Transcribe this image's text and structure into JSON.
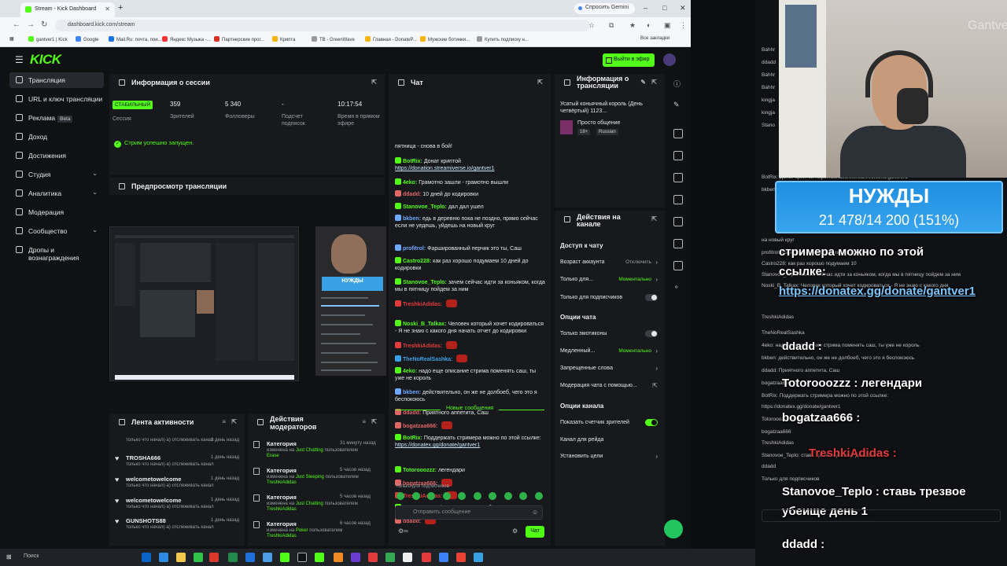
{
  "browser": {
    "tab_title": "Stream - Kick Dashboard",
    "new_tab": "+",
    "gemini": "Спросить Gemini",
    "url": "dashboard.kick.com/stream",
    "bookmarks": [
      "gantver1 | Kick",
      "Google",
      "Mail.Ru: почта, пои...",
      "Яндекс Музыка -...",
      "Партнерские прог...",
      "Крипта",
      "TB - GreenWave",
      "Главная - DonateP...",
      "Мужские ботинки...",
      "Купить подписку н..."
    ],
    "all_bookmarks": "Все закладки"
  },
  "app": {
    "logo": "KICK",
    "go_live": "Выйти в эфир"
  },
  "sidebar": {
    "items": [
      {
        "label": "Трансляция"
      },
      {
        "label": "URL и ключ трансляции"
      },
      {
        "label": "Реклама",
        "badge": "Beta"
      },
      {
        "label": "Доход"
      },
      {
        "label": "Достижения"
      },
      {
        "label": "Студия"
      },
      {
        "label": "Аналитика"
      },
      {
        "label": "Модерация"
      },
      {
        "label": "Сообщество"
      },
      {
        "label": "Дропы и вознаграждения"
      }
    ]
  },
  "session": {
    "title": "Информация о сессии",
    "live_badge": "СТАБИЛЬНЫЙ",
    "session_label": "Сессия",
    "viewers_value": "359",
    "viewers_label": "Зрителей",
    "followers_value": "5 340",
    "followers_label": "Фолловеры",
    "subs_value": "-",
    "subs_label": "Подсчет подписок",
    "time_value": "10:17:54",
    "time_label": "Время в прямом эфире",
    "status": "Стрим успешно запущен."
  },
  "preview": {
    "title": "Предпросмотр трансляции",
    "overlay_text": "НУЖДЫ"
  },
  "activity": {
    "title": "Лента активности",
    "rows": [
      {
        "name": "TROSHA666",
        "text": "только что начал(-а) отслеживать канал",
        "date": "1 день назад"
      },
      {
        "name": "welcometowelcome",
        "text": "только что начал(-а) отслеживать канал",
        "date": "1 день назад"
      },
      {
        "name": "welcometowelcome",
        "text": "только что начал(-а) отслеживать канал",
        "date": "1 день назад"
      },
      {
        "name": "GUNSHOTS88",
        "text": "только что начал(-а) отслеживать канал",
        "date": "1 день назад"
      }
    ],
    "top_line": "только что начал(-а) отслеживать канал",
    "top_date": "1 день назад"
  },
  "mod_actions": {
    "title": "Действия модераторов",
    "rows": [
      {
        "kind": "Категория",
        "date": "31 минуту назад",
        "pre": "изменена на",
        "cat": "Just Chatting",
        "post": "пользователем",
        "user": "Erase"
      },
      {
        "kind": "Категория",
        "date": "5 часов назад",
        "pre": "изменена на",
        "cat": "Just Sleeping",
        "post": "пользователем",
        "user": "TreshkiAdidas"
      },
      {
        "kind": "Категория",
        "date": "5 часов назад",
        "pre": "изменена на",
        "cat": "Just Chatting",
        "post": "пользователем",
        "user": "TreshkiAdidas"
      },
      {
        "kind": "Категория",
        "date": "6 часов назад",
        "pre": "изменена на",
        "cat": "Poker",
        "post": "пользователем",
        "user": "TreshkiAdidas"
      }
    ]
  },
  "chat": {
    "title": "Чат",
    "messages": [
      {
        "user": "",
        "text": "пятница - снова в бой!",
        "color": "#e6e6e6"
      },
      {
        "user": "BotRix:",
        "text": "Донат криптой ",
        "link": "https://donation.streamiverse.io/gantver1",
        "color": "#53fc18"
      },
      {
        "user": "4eko:",
        "text": "Грамотно зашли - грамотно вышли",
        "color": "#53fc18"
      },
      {
        "user": "ddadd:",
        "text": "10 дней до кодировки",
        "color": "#e06666"
      },
      {
        "user": "Stanovoe_Teplo:",
        "text": "дал дал ушел",
        "color": "#53fc18"
      },
      {
        "user": "bkben:",
        "text": "едь в деревню пока не поздно, прямо сейчас  если не уедешь, уйдешь на новый круг",
        "color": "#6ea8ff"
      },
      {
        "user": "profitrol:",
        "text": "Фаршированный перчик это ты, Саш",
        "color": "#6ea8ff"
      },
      {
        "user": "Castro228:",
        "text": "как раз хорошо подумаем 10 дней до кодировки",
        "color": "#53fc18"
      },
      {
        "user": "Stanovoe_Teplo:",
        "text": "зачем сейчас идти за коньяком, когда мы в пятницу пойдем за ним",
        "color": "#53fc18"
      },
      {
        "user": "TreshkiAdidas:",
        "text": "",
        "color": "#e23b3b"
      },
      {
        "user": "Noski_B_Talkax:",
        "text": "Человек который хочет кодироваться - Я не знаю с какого дня начать отчет до кодировки",
        "color": "#53fc18"
      },
      {
        "user": "TreshkiAdidas:",
        "text": "",
        "color": "#e23b3b"
      },
      {
        "user": "TheNoRealSashka:",
        "text": "",
        "color": "#3aa0e6"
      },
      {
        "user": "4eko:",
        "text": "надо еще описание стрима поменять саш, ты уже не король",
        "color": "#53fc18"
      },
      {
        "user": "bkben:",
        "text": "действительно, он же не долбоеб, чего это я беспокоюсь",
        "color": "#6ea8ff"
      },
      {
        "user": "ddadd:",
        "text": "Приятного аппетита, Саш",
        "color": "#e06666"
      },
      {
        "user": "bogatzaa666:",
        "text": "",
        "color": "#e06666"
      },
      {
        "user": "BotRix:",
        "text": "Поддержать стримера можно по этой ссылке: ",
        "link": "https://donatex.gg/donate/gantver1",
        "color": "#53fc18"
      }
    ],
    "new_messages": "Новые сообщения",
    "after": [
      {
        "user": "Totorooozzz:",
        "text": "легендари",
        "color": "#53fc18"
      },
      {
        "user": "bogatzaa666:",
        "text": "",
        "color": "#e06666"
      },
      {
        "user": "TreshkiAdidas:",
        "text": "",
        "color": "#e23b3b"
      },
      {
        "user": "Stanovoe_Teplo:",
        "text": "ставь трезвое убеище день 1",
        "color": "#53fc18"
      },
      {
        "user": "ddadd:",
        "text": "",
        "color": "#e06666"
      }
    ],
    "subs_only": "Только для подписчиков",
    "placeholder": "Отправить сообщение",
    "send": "Чат"
  },
  "stream_info": {
    "title": "Информация о трансляции",
    "stream_title": "Усатый коньячный король (День четвёртый) 1123...",
    "category": "Просто общение",
    "age": "18+",
    "lang": "Russian"
  },
  "channel_actions": {
    "title": "Действия на канале",
    "chat_access_title": "Доступ к чату",
    "rows1": [
      {
        "label": "Возраст аккаунта",
        "value": "Отключить",
        "green": false,
        "type": "chevron"
      },
      {
        "label": "Только для...",
        "value": "Моментально",
        "green": true,
        "type": "chevron"
      },
      {
        "label": "Только для подписчиков",
        "value": "",
        "green": false,
        "type": "toggle"
      }
    ],
    "chat_options_title": "Опции чата",
    "rows2": [
      {
        "label": "Только эмотиконы",
        "value": "",
        "type": "toggle"
      },
      {
        "label": "Медленный...",
        "value": "Моментально",
        "green": true,
        "type": "chevron"
      },
      {
        "label": "Запрещенные слова",
        "value": "",
        "type": "chevron"
      },
      {
        "label": "Модерация чата с помощью...",
        "value": "",
        "type": "ext"
      }
    ],
    "channel_options_title": "Опции канала",
    "rows3": [
      {
        "label": "Показать счетчик зрителей",
        "type": "toggle-on"
      },
      {
        "label": "Канал для рейда",
        "type": "none"
      },
      {
        "label": "Установить цели",
        "type": "chevron"
      }
    ]
  },
  "taskbar": {
    "search": "Поиск"
  },
  "obs": {
    "watermark": "Gantver1",
    "goal_title": "НУЖДЫ",
    "goal_progress": "21 478/14 200 (151%)",
    "overlay_text_1": "стримера можно по этой",
    "overlay_text_2": "ссылке:",
    "overlay_link": "https://donatex.gg/donate/gantver1",
    "overlay_user_1": "ddadd :",
    "overlay_msg_2": "Totorooozzz : легендари",
    "overlay_msg_3": "bogatzaa666 :",
    "overlay_msg_4": "TreshkiAdidas :",
    "overlay_msg_5a": "Stanovoe_Teplo : ставь трезвое",
    "overlay_msg_5b": "убеище день 1",
    "overlay_user_6": "ddadd :",
    "right_chat": [
      "Bahhr",
      "ddadd",
      "Bahhr",
      "Bahhr",
      "kingja",
      "kingja",
      "Stano",
      "BotRix: Донат криптой https://donation.streamiverse.io/gantver1",
      "bkben: едь в деревню пока не поздно, прямо сейчас",
      "на новый круг",
      "profitrol: Фаршированный перчик это ты, Саш",
      "Castro228: как раз хорошо подумаем 10",
      "Stanovoe_Teplo: зачем сейчас идти за коньяком, когда мы в пятницу пойдем за ним",
      "Noski_B_Talkax: Человек который хочет кодироваться - Я не знаю с какого дня",
      "TreshkiAdidas",
      "TheNoRealSashka",
      "4eko: надо еще описание стрима поменять саш, ты уже не король",
      "bkben: действительно, он же не долбоеб, чего это я беспокоюсь",
      "ddadd: Приятного аппетита, Саш",
      "bogatzaa666",
      "BotRix: Поддержать стримера можно по этой ссылке:",
      "https://donatex.gg/donate/gantver1",
      "Totorooozzz: легендари",
      "bogatzaa666",
      "TreshkiAdidas",
      "Stanovoe_Teplo: ставь трезвое убеище день 1",
      "ddadd",
      "Только для подписчиков"
    ]
  }
}
